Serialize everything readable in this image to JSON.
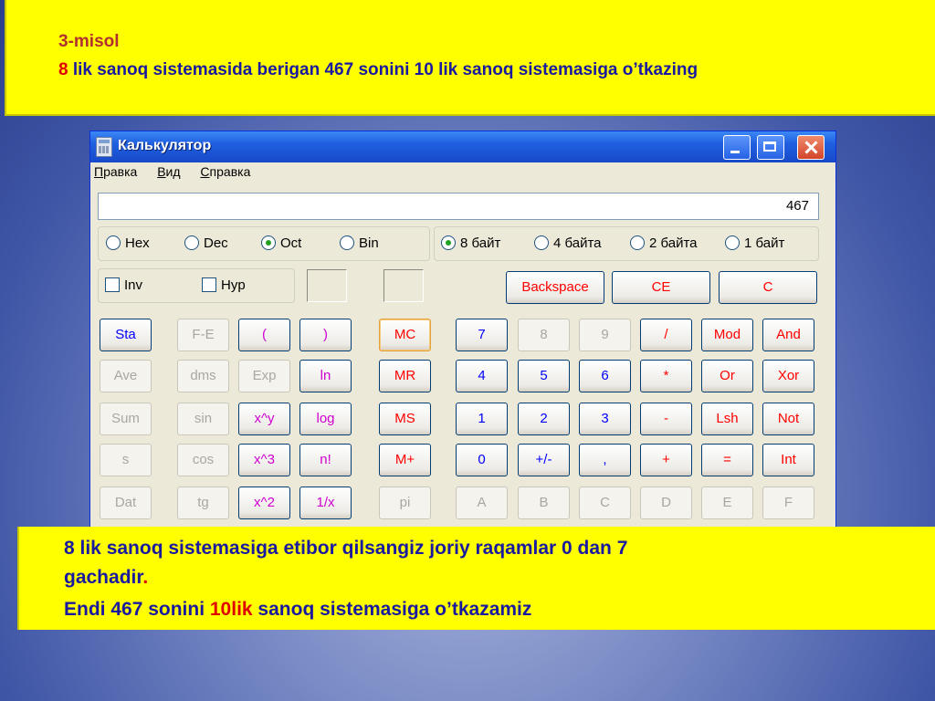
{
  "slide": {
    "heading": "3-misol",
    "task_prefix": "8",
    "task_rest": " lik sanoq sistemasida berigan 467 sonini 10 lik sanoq sistemasiga o’tkazing",
    "note_line1": "8 lik sanoq sistemasiga etibor qilsangiz joriy raqamlar 0 dan 7",
    "note_line2": "gachadir",
    "note_line2_dot": ".",
    "note_line3_a": "Endi 467 sonini ",
    "note_line3_red": "10lik",
    "note_line3_b": " sanoq sistemasiga o’tkazamiz"
  },
  "window": {
    "title": "Калькулятор",
    "menu": [
      {
        "accel": "П",
        "rest": "равка"
      },
      {
        "accel": "В",
        "rest": "ид"
      },
      {
        "accel": "С",
        "rest": "правка"
      }
    ]
  },
  "display": {
    "value": "467"
  },
  "base": {
    "options": [
      "Hex",
      "Dec",
      "Oct",
      "Bin"
    ],
    "selected": "Oct"
  },
  "word_size": {
    "options": [
      "8 байт",
      "4 байта",
      "2 байта",
      "1 байт"
    ],
    "selected": "8 байт"
  },
  "checks": {
    "inv": "Inv",
    "hyp": "Hyp"
  },
  "top_buttons": {
    "backspace": "Backspace",
    "ce": "CE",
    "c": "C"
  },
  "keys": {
    "sta": "Sta",
    "fe": "F-E",
    "lparen": "(",
    "rparen": ")",
    "mc": "MC",
    "d7": "7",
    "d8": "8",
    "d9": "9",
    "div": "/",
    "mod": "Mod",
    "and": "And",
    "ave": "Ave",
    "dms": "dms",
    "exp": "Exp",
    "ln": "ln",
    "mr": "MR",
    "d4": "4",
    "d5": "5",
    "d6": "6",
    "mul": "*",
    "or": "Or",
    "xor": "Xor",
    "sum": "Sum",
    "sin": "sin",
    "xpowy": "x^y",
    "log": "log",
    "ms": "MS",
    "d1": "1",
    "d2": "2",
    "d3": "3",
    "sub": "-",
    "lsh": "Lsh",
    "not": "Not",
    "s": "s",
    "cos": "cos",
    "xcube": "x^3",
    "fact": "n!",
    "mplus": "M+",
    "d0": "0",
    "sign": "+/-",
    "dot": ",",
    "add": "+",
    "eq": "=",
    "int": "Int",
    "dat": "Dat",
    "tg": "tg",
    "xsq": "x^2",
    "recip": "1/x",
    "pi": "pi",
    "a": "A",
    "b": "B",
    "c2": "C",
    "d": "D",
    "e": "E",
    "f": "F"
  }
}
